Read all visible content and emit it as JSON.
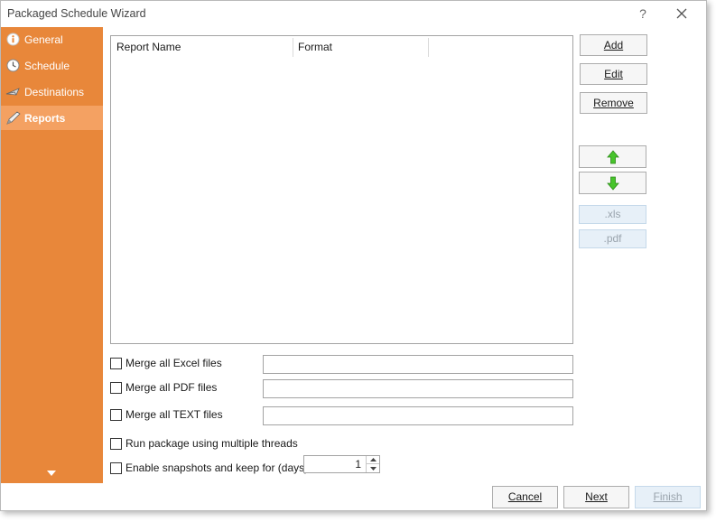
{
  "window": {
    "title": "Packaged Schedule Wizard",
    "help_label": "?"
  },
  "sidebar": {
    "items": [
      {
        "label": "General",
        "icon": "info-icon"
      },
      {
        "label": "Schedule",
        "icon": "clock-icon"
      },
      {
        "label": "Destinations",
        "icon": "plane-icon"
      },
      {
        "label": "Reports",
        "icon": "pen-icon",
        "active": true
      }
    ]
  },
  "reports_list": {
    "columns": [
      "Report Name",
      "Format"
    ],
    "rows": []
  },
  "buttons": {
    "add": "Add",
    "edit": "Edit",
    "remove": "Remove",
    "move_up": "up-arrow-icon",
    "move_down": "down-arrow-icon",
    "xls": ".xls",
    "pdf": ".pdf"
  },
  "merge_options": [
    {
      "label": "Merge all Excel files",
      "checked": false,
      "value": ""
    },
    {
      "label": "Merge all PDF files",
      "checked": false,
      "value": ""
    },
    {
      "label": "Merge all TEXT files",
      "checked": false,
      "value": ""
    }
  ],
  "options": {
    "threads_label": "Run package using multiple threads",
    "threads_checked": false,
    "snapshots_label": "Enable snapshots and keep for (days)",
    "snapshots_checked": false,
    "snapshots_days": "1"
  },
  "footer": {
    "cancel": "Cancel",
    "next": "Next",
    "finish": "Finish"
  },
  "colors": {
    "sidebar": "#e8873a",
    "sidebar_active": "#f4a162",
    "arrow_green": "#3fbf24"
  }
}
